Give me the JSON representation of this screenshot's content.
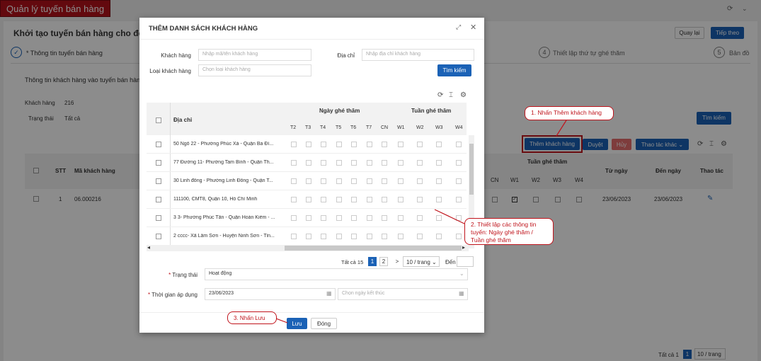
{
  "app": {
    "title": "Quản lý tuyến bán hàng"
  },
  "page": {
    "header": "Khởi tạo tuyến bán hàng cho đơn vị",
    "back_btn": "Quay lại",
    "next_btn": "Tiếp theo",
    "steps": [
      {
        "num": "✓",
        "label": "* Thông tin tuyến bán hàng"
      },
      {
        "num": "4",
        "label": "Thiết lập thứ tự ghé thăm"
      },
      {
        "num": "5",
        "label": "Bản đồ"
      }
    ],
    "section_title": "Thông tin khách hàng vào tuyến bán hàng",
    "filters": {
      "khach_hang_label": "Khách hàng",
      "khach_hang_value": "216",
      "trang_thai_label": "Trạng thái",
      "trang_thai_value": "Tất cả"
    },
    "search_btn": "Tìm kiếm",
    "actions": {
      "add": "Thêm khách hàng",
      "approve": "Duyệt",
      "cancel": "Hủy",
      "more": "Thao tác khác"
    },
    "table": {
      "stt": "STT",
      "ma_kh": "Mã khách hàng",
      "tuan_ghe_tham": "Tuần ghé thăm",
      "cols": [
        "CN",
        "W1",
        "W2",
        "W3",
        "W4"
      ],
      "tu_ngay": "Từ ngày",
      "den_ngay": "Đến ngày",
      "thao_tac": "Thao tác",
      "row": {
        "stt": "1",
        "ma": "06.000216",
        "tu": "23/06/2023",
        "den": "23/06/2023"
      }
    },
    "pager": {
      "total": "Tất cả 1",
      "page": "1",
      "size": "10 / trang"
    }
  },
  "modal": {
    "title": "THÊM DANH SÁCH KHÁCH HÀNG",
    "khach_hang_label": "Khách hàng",
    "khach_hang_ph": "Nhập mã/tên khách hàng",
    "dia_chi_label": "Địa chỉ",
    "dia_chi_ph": "Nhập địa chỉ khách hàng",
    "loai_label": "Loại khách hàng",
    "loai_ph": "Chọn loại khách hàng",
    "search_btn": "Tìm kiếm",
    "table": {
      "dia_chi": "Địa chỉ",
      "ngay_ghe_tham": "Ngày ghé thăm",
      "tuan_ghe_tham": "Tuần ghé thăm",
      "days": [
        "T2",
        "T3",
        "T4",
        "T5",
        "T6",
        "T7",
        "CN"
      ],
      "weeks": [
        "W1",
        "W2",
        "W3",
        "W4"
      ],
      "rows": [
        "50 Ngõ 22 - Phường Phúc Xá - Quận Ba Đì...",
        "77 Đường 11- Phường Tam Bình - Quận Th...",
        "30 Linh đông - Phường Linh Đông - Quận T...",
        "111100, CMT8, Quận 10, Hồ Chí Minh",
        "3 3- Phường Phúc Tân - Quận Hoàn Kiếm - ...",
        "2 cccc- Xã Lâm Sơn - Huyện Ninh Sơn - Tỉn..."
      ]
    },
    "pager": {
      "total": "Tất cả 15",
      "p1": "1",
      "p2": "2",
      "next": ">",
      "size": "10 / trang",
      "goto": "Đến"
    },
    "trang_thai_label": "* Trạng thái",
    "trang_thai_value": "Hoạt động",
    "thoi_gian_label": "* Thời gian áp dụng",
    "tu_ngay": "23/06/2023",
    "den_ngay_ph": "Chọn ngày kết thúc",
    "save_btn": "Lưu",
    "close_btn": "Đóng"
  },
  "callouts": {
    "c1": "1. Nhấn Thêm khách hàng",
    "c2": "2. Thiết lập các thông tin tuyến: Ngày ghé thăm / Tuần ghé thăm",
    "c3": "3. Nhấn Lưu"
  }
}
